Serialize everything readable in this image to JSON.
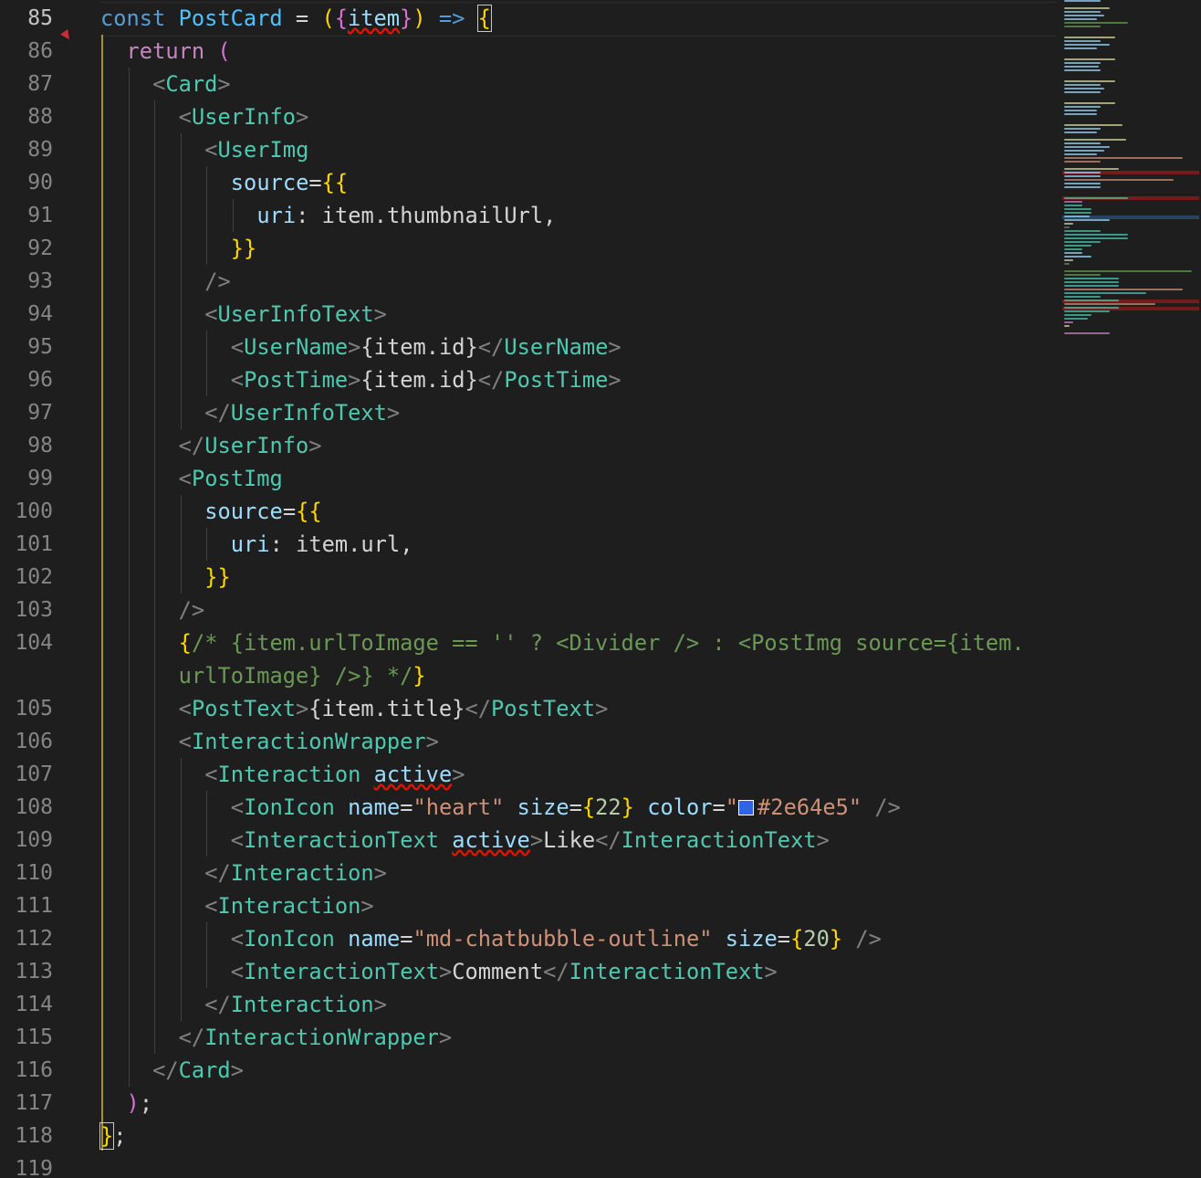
{
  "editor": {
    "first_line": 85,
    "current_line": 85,
    "color_swatch": "#2e64e5",
    "lines": [
      {
        "n": "85",
        "indent": 0,
        "tokens": [
          [
            "kw",
            "const "
          ],
          [
            "var",
            "PostCard"
          ],
          [
            "txt",
            " = "
          ],
          [
            "b1",
            "("
          ],
          [
            "b2",
            "{"
          ],
          [
            "attr squig",
            "item"
          ],
          [
            "b2",
            "}"
          ],
          [
            "b1",
            ")"
          ],
          [
            "kw",
            " => "
          ],
          [
            "b1 cursor-box",
            "{"
          ]
        ]
      },
      {
        "n": "86",
        "indent": 1,
        "tokens": [
          [
            "kwc",
            "return "
          ],
          [
            "b2",
            "("
          ]
        ]
      },
      {
        "n": "87",
        "indent": 2,
        "tokens": [
          [
            "punct",
            "<"
          ],
          [
            "tag",
            "Card"
          ],
          [
            "punct",
            ">"
          ]
        ]
      },
      {
        "n": "88",
        "indent": 3,
        "tokens": [
          [
            "punct",
            "<"
          ],
          [
            "tag",
            "UserInfo"
          ],
          [
            "punct",
            ">"
          ]
        ]
      },
      {
        "n": "89",
        "indent": 4,
        "tokens": [
          [
            "punct",
            "<"
          ],
          [
            "tag",
            "UserImg"
          ]
        ]
      },
      {
        "n": "90",
        "indent": 5,
        "tokens": [
          [
            "attr",
            "source"
          ],
          [
            "txt",
            "="
          ],
          [
            "b1",
            "{{"
          ]
        ]
      },
      {
        "n": "91",
        "indent": 6,
        "tokens": [
          [
            "attr",
            "uri"
          ],
          [
            "txt",
            ": item.thumbnailUrl,"
          ]
        ]
      },
      {
        "n": "92",
        "indent": 5,
        "tokens": [
          [
            "b1",
            "}}"
          ]
        ]
      },
      {
        "n": "93",
        "indent": 4,
        "tokens": [
          [
            "punct",
            "/>"
          ]
        ]
      },
      {
        "n": "94",
        "indent": 4,
        "tokens": [
          [
            "punct",
            "<"
          ],
          [
            "tag",
            "UserInfoText"
          ],
          [
            "punct",
            ">"
          ]
        ]
      },
      {
        "n": "95",
        "indent": 5,
        "tokens": [
          [
            "punct",
            "<"
          ],
          [
            "tag",
            "UserName"
          ],
          [
            "punct",
            ">"
          ],
          [
            "txt",
            "{item.id}"
          ],
          [
            "punct",
            "</"
          ],
          [
            "tag",
            "UserName"
          ],
          [
            "punct",
            ">"
          ]
        ]
      },
      {
        "n": "96",
        "indent": 5,
        "tokens": [
          [
            "punct",
            "<"
          ],
          [
            "tag",
            "PostTime"
          ],
          [
            "punct",
            ">"
          ],
          [
            "txt",
            "{item.id}"
          ],
          [
            "punct",
            "</"
          ],
          [
            "tag",
            "PostTime"
          ],
          [
            "punct",
            ">"
          ]
        ]
      },
      {
        "n": "97",
        "indent": 4,
        "tokens": [
          [
            "punct",
            "</"
          ],
          [
            "tag",
            "UserInfoText"
          ],
          [
            "punct",
            ">"
          ]
        ]
      },
      {
        "n": "98",
        "indent": 3,
        "tokens": [
          [
            "punct",
            "</"
          ],
          [
            "tag",
            "UserInfo"
          ],
          [
            "punct",
            ">"
          ]
        ]
      },
      {
        "n": "99",
        "indent": 3,
        "tokens": [
          [
            "punct",
            "<"
          ],
          [
            "tag",
            "PostImg"
          ]
        ]
      },
      {
        "n": "100",
        "indent": 4,
        "tokens": [
          [
            "attr",
            "source"
          ],
          [
            "txt",
            "="
          ],
          [
            "b1",
            "{{"
          ]
        ]
      },
      {
        "n": "101",
        "indent": 5,
        "tokens": [
          [
            "attr",
            "uri"
          ],
          [
            "txt",
            ": item.url,"
          ]
        ]
      },
      {
        "n": "102",
        "indent": 4,
        "tokens": [
          [
            "b1",
            "}}"
          ]
        ]
      },
      {
        "n": "103",
        "indent": 3,
        "tokens": [
          [
            "punct",
            "/>"
          ]
        ]
      },
      {
        "n": "104",
        "indent": 3,
        "tokens": [
          [
            "b1",
            "{"
          ],
          [
            "cmt",
            "/* {item.urlToImage == '' ? <Divider /> : <PostImg source={item."
          ]
        ]
      },
      {
        "n": "",
        "indent": 3,
        "tokens": [
          [
            "cmt",
            "urlToImage} />} */"
          ],
          [
            "b1",
            "}"
          ]
        ]
      },
      {
        "n": "105",
        "indent": 3,
        "tokens": [
          [
            "punct",
            "<"
          ],
          [
            "tag",
            "PostText"
          ],
          [
            "punct",
            ">"
          ],
          [
            "txt",
            "{item.title}"
          ],
          [
            "punct",
            "</"
          ],
          [
            "tag",
            "PostText"
          ],
          [
            "punct",
            ">"
          ]
        ]
      },
      {
        "n": "106",
        "indent": 3,
        "tokens": [
          [
            "punct",
            "<"
          ],
          [
            "tag",
            "InteractionWrapper"
          ],
          [
            "punct",
            ">"
          ]
        ]
      },
      {
        "n": "107",
        "indent": 4,
        "tokens": [
          [
            "punct",
            "<"
          ],
          [
            "tag",
            "Interaction"
          ],
          [
            "txt",
            " "
          ],
          [
            "attr squig",
            "active"
          ],
          [
            "punct",
            ">"
          ]
        ]
      },
      {
        "n": "108",
        "indent": 5,
        "tokens": [
          [
            "punct",
            "<"
          ],
          [
            "tag",
            "IonIcon"
          ],
          [
            "txt",
            " "
          ],
          [
            "attr",
            "name"
          ],
          [
            "txt",
            "="
          ],
          [
            "str",
            "\"heart\""
          ],
          [
            "txt",
            " "
          ],
          [
            "attr",
            "size"
          ],
          [
            "txt",
            "="
          ],
          [
            "b1",
            "{"
          ],
          [
            "num",
            "22"
          ],
          [
            "b1",
            "}"
          ],
          [
            "txt",
            " "
          ],
          [
            "attr",
            "color"
          ],
          [
            "txt",
            "="
          ],
          [
            "str",
            "\""
          ],
          [
            "swatch",
            ""
          ],
          [
            "str",
            "#2e64e5\""
          ],
          [
            "txt",
            " "
          ],
          [
            "punct",
            "/>"
          ]
        ]
      },
      {
        "n": "109",
        "indent": 5,
        "tokens": [
          [
            "punct",
            "<"
          ],
          [
            "tag",
            "InteractionText"
          ],
          [
            "txt",
            " "
          ],
          [
            "attr squig",
            "active"
          ],
          [
            "punct",
            ">"
          ],
          [
            "txt",
            "Like"
          ],
          [
            "punct",
            "</"
          ],
          [
            "tag",
            "InteractionText"
          ],
          [
            "punct",
            ">"
          ]
        ]
      },
      {
        "n": "110",
        "indent": 4,
        "tokens": [
          [
            "punct",
            "</"
          ],
          [
            "tag",
            "Interaction"
          ],
          [
            "punct",
            ">"
          ]
        ]
      },
      {
        "n": "111",
        "indent": 4,
        "tokens": [
          [
            "punct",
            "<"
          ],
          [
            "tag",
            "Interaction"
          ],
          [
            "punct",
            ">"
          ]
        ]
      },
      {
        "n": "112",
        "indent": 5,
        "tokens": [
          [
            "punct",
            "<"
          ],
          [
            "tag",
            "IonIcon"
          ],
          [
            "txt",
            " "
          ],
          [
            "attr",
            "name"
          ],
          [
            "txt",
            "="
          ],
          [
            "str",
            "\"md-chatbubble-outline\""
          ],
          [
            "txt",
            " "
          ],
          [
            "attr",
            "size"
          ],
          [
            "txt",
            "="
          ],
          [
            "b1",
            "{"
          ],
          [
            "num",
            "20"
          ],
          [
            "b1",
            "}"
          ],
          [
            "txt",
            " "
          ],
          [
            "punct",
            "/>"
          ]
        ]
      },
      {
        "n": "113",
        "indent": 5,
        "tokens": [
          [
            "punct",
            "<"
          ],
          [
            "tag",
            "InteractionText"
          ],
          [
            "punct",
            ">"
          ],
          [
            "txt",
            "Comment"
          ],
          [
            "punct",
            "</"
          ],
          [
            "tag",
            "InteractionText"
          ],
          [
            "punct",
            ">"
          ]
        ]
      },
      {
        "n": "114",
        "indent": 4,
        "tokens": [
          [
            "punct",
            "</"
          ],
          [
            "tag",
            "Interaction"
          ],
          [
            "punct",
            ">"
          ]
        ]
      },
      {
        "n": "115",
        "indent": 3,
        "tokens": [
          [
            "punct",
            "</"
          ],
          [
            "tag",
            "InteractionWrapper"
          ],
          [
            "punct",
            ">"
          ]
        ]
      },
      {
        "n": "116",
        "indent": 2,
        "tokens": [
          [
            "punct",
            "</"
          ],
          [
            "tag",
            "Card"
          ],
          [
            "punct",
            ">"
          ]
        ]
      },
      {
        "n": "117",
        "indent": 1,
        "tokens": [
          [
            "b2",
            ")"
          ],
          [
            "txt",
            ";"
          ]
        ]
      },
      {
        "n": "118",
        "indent": 0,
        "tokens": [
          [
            "b1 cursor-box",
            "}"
          ],
          [
            "txt",
            ";"
          ]
        ]
      },
      {
        "n": "119",
        "indent": 0,
        "tokens": []
      }
    ]
  }
}
